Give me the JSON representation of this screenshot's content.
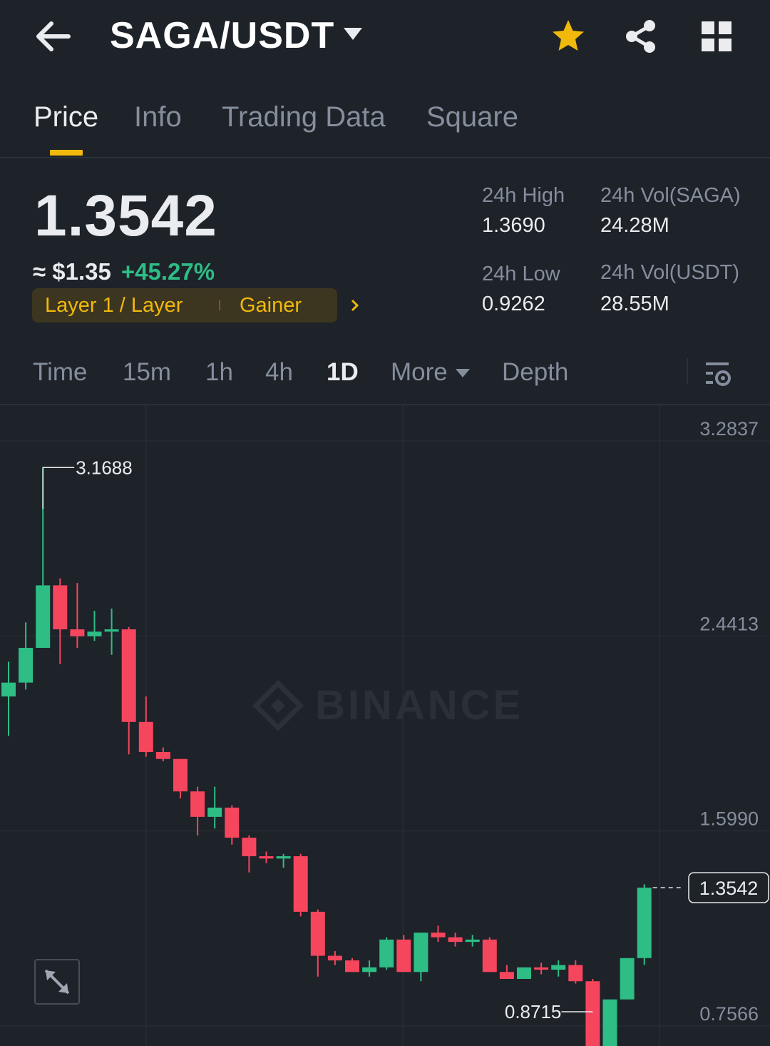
{
  "header": {
    "pair": "SAGA/USDT",
    "back_icon": "arrow-left-icon",
    "favorite_icon": "star-icon",
    "share_icon": "share-icon",
    "layout_icon": "grid-icon",
    "favorite_color": "#f0b90b"
  },
  "tabs": [
    {
      "label": "Price",
      "active": true
    },
    {
      "label": "Info",
      "active": false
    },
    {
      "label": "Trading Data",
      "active": false
    },
    {
      "label": "Square",
      "active": false
    }
  ],
  "price": {
    "last": "1.3542",
    "fiat": "≈ $1.35",
    "change": "+45.27%",
    "tag_category": "Layer 1 / Layer",
    "tag_rank": "Gainer"
  },
  "stats": {
    "high_label": "24h High",
    "high": "1.3690",
    "low_label": "24h Low",
    "low": "0.9262",
    "vol_base_label": "24h Vol(SAGA)",
    "vol_base": "24.28M",
    "vol_quote_label": "24h Vol(USDT)",
    "vol_quote": "28.55M"
  },
  "intervals": {
    "items": [
      "Time",
      "15m",
      "1h",
      "4h",
      "1D",
      "More",
      "Depth"
    ],
    "active": "1D",
    "settings_icon": "chart-settings-icon"
  },
  "colors": {
    "up": "#2ebd85",
    "down": "#f6465d",
    "accent": "#f0b90b",
    "background": "#1e2229"
  },
  "chart_data": {
    "type": "candlestick",
    "interval": "1D",
    "watermark": "BINANCE",
    "y_ticks": [
      "3.2837",
      "2.4413",
      "1.5990",
      "0.7566"
    ],
    "ylim": [
      0.7566,
      3.2837
    ],
    "last_price_label": "1.3542",
    "high_marker": "3.1688",
    "low_marker": "0.8715",
    "candles": [
      {
        "o": 2.18,
        "h": 2.33,
        "l": 2.01,
        "c": 2.24
      },
      {
        "o": 2.24,
        "h": 2.5,
        "l": 2.21,
        "c": 2.39
      },
      {
        "o": 2.39,
        "h": 3.1688,
        "l": 2.39,
        "c": 2.66
      },
      {
        "o": 2.66,
        "h": 2.69,
        "l": 2.32,
        "c": 2.47
      },
      {
        "o": 2.47,
        "h": 2.67,
        "l": 2.39,
        "c": 2.44
      },
      {
        "o": 2.44,
        "h": 2.55,
        "l": 2.42,
        "c": 2.46
      },
      {
        "o": 2.46,
        "h": 2.56,
        "l": 2.36,
        "c": 2.47
      },
      {
        "o": 2.47,
        "h": 2.48,
        "l": 1.93,
        "c": 2.07
      },
      {
        "o": 2.07,
        "h": 2.18,
        "l": 1.92,
        "c": 1.94
      },
      {
        "o": 1.94,
        "h": 1.96,
        "l": 1.9,
        "c": 1.91
      },
      {
        "o": 1.91,
        "h": 1.91,
        "l": 1.74,
        "c": 1.77
      },
      {
        "o": 1.77,
        "h": 1.79,
        "l": 1.58,
        "c": 1.66
      },
      {
        "o": 1.66,
        "h": 1.79,
        "l": 1.61,
        "c": 1.7
      },
      {
        "o": 1.7,
        "h": 1.71,
        "l": 1.54,
        "c": 1.57
      },
      {
        "o": 1.57,
        "h": 1.58,
        "l": 1.42,
        "c": 1.49
      },
      {
        "o": 1.49,
        "h": 1.51,
        "l": 1.46,
        "c": 1.48
      },
      {
        "o": 1.48,
        "h": 1.5,
        "l": 1.44,
        "c": 1.49
      },
      {
        "o": 1.49,
        "h": 1.5,
        "l": 1.23,
        "c": 1.25
      },
      {
        "o": 1.25,
        "h": 1.26,
        "l": 0.97,
        "c": 1.06
      },
      {
        "o": 1.06,
        "h": 1.08,
        "l": 1.02,
        "c": 1.04
      },
      {
        "o": 1.04,
        "h": 1.05,
        "l": 0.99,
        "c": 0.99
      },
      {
        "o": 0.99,
        "h": 1.04,
        "l": 0.97,
        "c": 1.01
      },
      {
        "o": 1.01,
        "h": 1.14,
        "l": 1.0,
        "c": 1.13
      },
      {
        "o": 1.13,
        "h": 1.15,
        "l": 0.99,
        "c": 0.99
      },
      {
        "o": 0.99,
        "h": 1.16,
        "l": 0.95,
        "c": 1.16
      },
      {
        "o": 1.16,
        "h": 1.19,
        "l": 1.12,
        "c": 1.14
      },
      {
        "o": 1.14,
        "h": 1.16,
        "l": 1.1,
        "c": 1.12
      },
      {
        "o": 1.12,
        "h": 1.15,
        "l": 1.1,
        "c": 1.13
      },
      {
        "o": 1.13,
        "h": 1.14,
        "l": 0.99,
        "c": 0.99
      },
      {
        "o": 0.99,
        "h": 1.02,
        "l": 0.96,
        "c": 0.96
      },
      {
        "o": 0.96,
        "h": 1.01,
        "l": 0.96,
        "c": 1.01
      },
      {
        "o": 1.01,
        "h": 1.03,
        "l": 0.98,
        "c": 1.0
      },
      {
        "o": 1.0,
        "h": 1.04,
        "l": 0.97,
        "c": 1.02
      },
      {
        "o": 1.02,
        "h": 1.04,
        "l": 0.94,
        "c": 0.95
      },
      {
        "o": 0.95,
        "h": 0.96,
        "l": 0.64,
        "c": 0.65
      },
      {
        "o": 0.65,
        "h": 0.66,
        "l": 0.8715,
        "c": 0.8715
      },
      {
        "o": 0.8715,
        "h": 1.05,
        "l": 0.8715,
        "c": 1.05
      },
      {
        "o": 1.05,
        "h": 1.369,
        "l": 1.02,
        "c": 1.3542
      }
    ]
  }
}
